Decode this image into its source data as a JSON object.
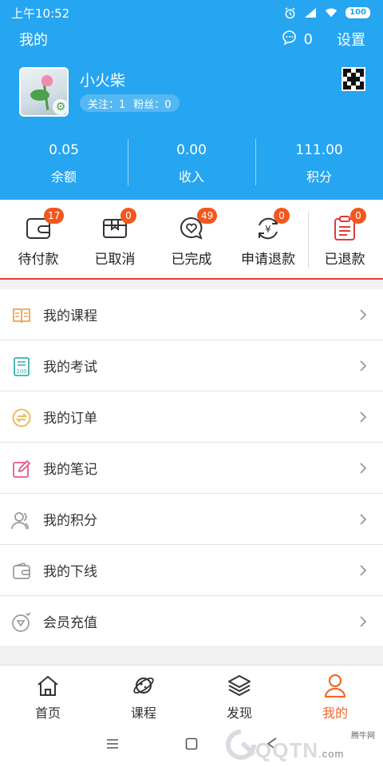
{
  "status_bar": {
    "time": "上午10:52",
    "battery": "100"
  },
  "header": {
    "title": "我的",
    "message_count": "0",
    "settings_label": "设置"
  },
  "profile": {
    "username": "小火柴",
    "following_label": "关注：1",
    "followers_label": "粉丝：0"
  },
  "stats": [
    {
      "value": "0.05",
      "label": "余额"
    },
    {
      "value": "0.00",
      "label": "收入"
    },
    {
      "value": "111.00",
      "label": "积分"
    }
  ],
  "orders": [
    {
      "label": "待付款",
      "badge": "17",
      "icon": "wallet-icon"
    },
    {
      "label": "已取消",
      "badge": "0",
      "icon": "box-icon"
    },
    {
      "label": "已完成",
      "badge": "49",
      "icon": "heart-chat-icon"
    },
    {
      "label": "申请退款",
      "badge": "0",
      "icon": "refund-yen-icon"
    },
    {
      "label": "已退款",
      "badge": "0",
      "icon": "clipboard-icon"
    }
  ],
  "menu": [
    {
      "label": "我的课程",
      "icon": "book-icon",
      "color": "#f3a24a"
    },
    {
      "label": "我的考试",
      "icon": "exam-icon",
      "color": "#3ab0a7"
    },
    {
      "label": "我的订单",
      "icon": "exchange-icon",
      "color": "#f3b24a"
    },
    {
      "label": "我的笔记",
      "icon": "edit-icon",
      "color": "#e8588d"
    },
    {
      "label": "我的积分",
      "icon": "users-icon",
      "color": "#999999"
    },
    {
      "label": "我的下线",
      "icon": "wallet-outline-icon",
      "color": "#999999"
    },
    {
      "label": "会员充值",
      "icon": "vip-diamond-icon",
      "color": "#999999"
    }
  ],
  "tabs": [
    {
      "label": "首页",
      "icon": "home-icon",
      "active": false
    },
    {
      "label": "课程",
      "icon": "planet-icon",
      "active": false
    },
    {
      "label": "发现",
      "icon": "layers-icon",
      "active": false
    },
    {
      "label": "我的",
      "icon": "user-icon",
      "active": true
    }
  ],
  "watermark": {
    "site": "腾牛网",
    "brand": "QQTN",
    "suffix": ".com"
  },
  "colors": {
    "header_blue": "#26a5f0",
    "badge_orange": "#f2571d",
    "active_tab": "#f2682a",
    "accent_red": "#e23b3b"
  }
}
